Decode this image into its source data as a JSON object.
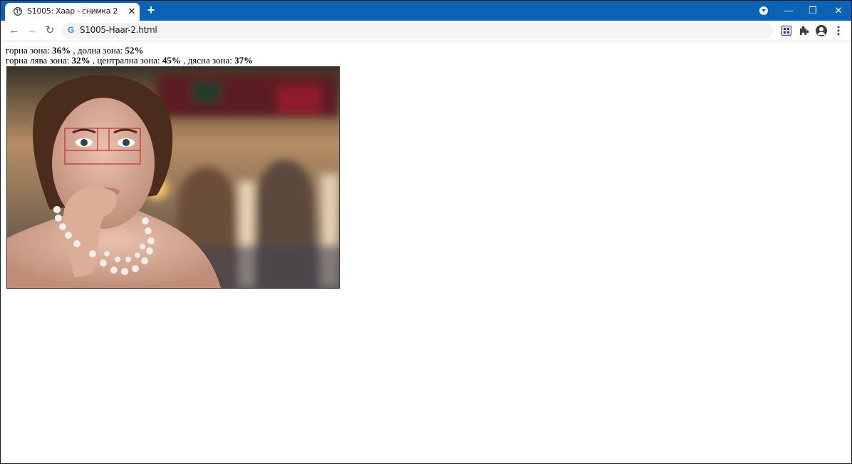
{
  "browser": {
    "tab_title": "S1005: Хаар - снимка 2",
    "tab_close": "✕",
    "new_tab": "+",
    "url": "S1005-Haar-2.html",
    "omnibox_icon": "G",
    "window_controls": {
      "minimize": "—",
      "restore": "❐",
      "close": "✕"
    },
    "nav": {
      "back": "←",
      "forward": "→",
      "reload": "↻"
    },
    "icons": [
      "globe-icon",
      "close-icon",
      "plus-icon",
      "profile-menu-icon",
      "google-icon",
      "qr-extension-icon",
      "puzzle-icon",
      "account-icon",
      "kebab-menu-icon"
    ]
  },
  "page": {
    "line1": {
      "label_top": "горна зона:",
      "value_top": "36%",
      "sep": ",",
      "label_bottom": "долна зона:",
      "value_bottom": "52%"
    },
    "line2": {
      "label_left": "горна лява зона:",
      "value_left": "32%",
      "sep1": ",",
      "label_center": "централна зона:",
      "value_center": "45%",
      "sep2": ",",
      "label_right": "дясна зона:",
      "value_right": "37%"
    }
  },
  "colors": {
    "titlebar": "#0b63b6",
    "detection_box": "#d0263f"
  }
}
